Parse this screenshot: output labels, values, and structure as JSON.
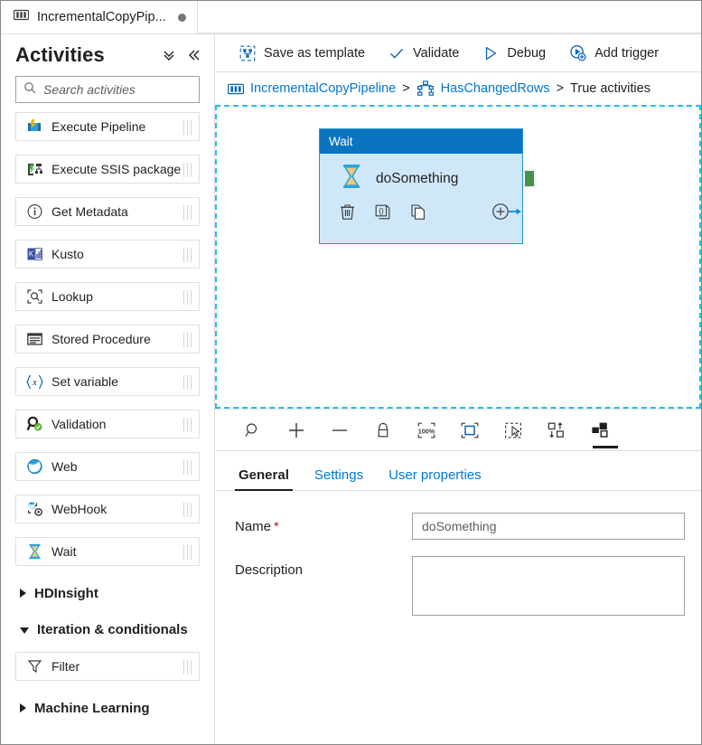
{
  "tab": {
    "title": "IncrementalCopyPip...",
    "icon": "pipeline-icon",
    "modified_dot": true
  },
  "sidebar": {
    "title": "Activities",
    "expand_all_icon": "double-chevron-down-icon",
    "collapse_icon": "double-chevron-left-icon",
    "search": {
      "placeholder": "Search activities",
      "value": "",
      "icon": "search-icon"
    },
    "items": [
      {
        "label": "Execute Pipeline",
        "icon": "execute-pipeline-icon"
      },
      {
        "label": "Execute SSIS package",
        "icon": "execute-ssis-package-icon"
      },
      {
        "label": "Get Metadata",
        "icon": "get-metadata-icon"
      },
      {
        "label": "Kusto",
        "icon": "kusto-icon"
      },
      {
        "label": "Lookup",
        "icon": "lookup-icon"
      },
      {
        "label": "Stored Procedure",
        "icon": "stored-procedure-icon"
      },
      {
        "label": "Set variable",
        "icon": "set-variable-icon"
      },
      {
        "label": "Validation",
        "icon": "validation-icon"
      },
      {
        "label": "Web",
        "icon": "web-icon"
      },
      {
        "label": "WebHook",
        "icon": "webhook-icon"
      },
      {
        "label": "Wait",
        "icon": "wait-icon"
      }
    ],
    "groups": [
      {
        "label": "HDInsight",
        "expanded": false
      },
      {
        "label": "Iteration & conditionals",
        "expanded": true
      },
      {
        "label": "Machine Learning",
        "expanded": false
      }
    ],
    "group_items": [
      {
        "label": "Filter",
        "icon": "filter-icon"
      }
    ]
  },
  "command_bar": {
    "items": [
      {
        "label": "Save as template",
        "icon": "save-as-template-icon"
      },
      {
        "label": "Validate",
        "icon": "checkmark-icon"
      },
      {
        "label": "Debug",
        "icon": "play-triangle-icon"
      },
      {
        "label": "Add trigger",
        "icon": "add-trigger-icon"
      }
    ]
  },
  "breadcrumb": {
    "pipeline_icon": "pipeline-icon",
    "pipeline": "IncrementalCopyPipeline",
    "sep1": ">",
    "condition_icon": "if-condition-icon",
    "condition": "HasChangedRows",
    "sep2": ">",
    "current": "True activities"
  },
  "canvas": {
    "node": {
      "type": "Wait",
      "name": "doSomething",
      "icon": "hourglass-icon",
      "tools": [
        {
          "name": "delete-icon"
        },
        {
          "name": "code-brackets-icon"
        },
        {
          "name": "clone-icon"
        },
        {
          "name": "add-output-icon"
        }
      ],
      "output_port_color": "#4a8f4a"
    },
    "selection_border_color": "#1ec0ef"
  },
  "canvas_toolbar": {
    "items": [
      {
        "name": "zoom-search-icon"
      },
      {
        "name": "zoom-in-icon"
      },
      {
        "name": "zoom-out-icon"
      },
      {
        "name": "lock-icon"
      },
      {
        "name": "zoom-100-percent-icon",
        "label": "100%"
      },
      {
        "name": "zoom-to-fit-icon"
      },
      {
        "name": "marquee-select-icon"
      },
      {
        "name": "auto-align-icon"
      },
      {
        "name": "show-related-icon"
      }
    ]
  },
  "property_tabs": [
    {
      "label": "General",
      "active": true
    },
    {
      "label": "Settings",
      "active": false
    },
    {
      "label": "User properties",
      "active": false
    }
  ],
  "form": {
    "name_label": "Name",
    "name_required": "*",
    "name_value": "doSomething",
    "description_label": "Description",
    "description_value": ""
  },
  "colors": {
    "accent": "#0078d4",
    "node_header": "#0a74c0",
    "node_body": "#cfe8f9",
    "selection": "#1ec0ef",
    "required": "#a4262c"
  }
}
